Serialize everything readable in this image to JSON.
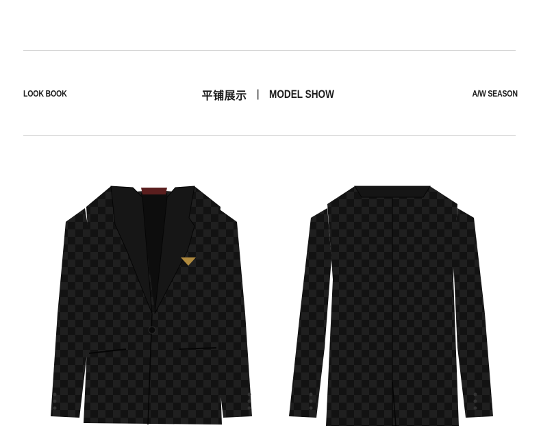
{
  "header": {
    "left_label": "LOOK BOOK",
    "center_title_cn": "平铺展示",
    "separator": "|",
    "center_title_en": "MODEL SHOW",
    "right_label": "A/W SEASON"
  },
  "images": {
    "front": {
      "subject": "black checkered blazer front view"
    },
    "back": {
      "subject": "black checkered blazer back view"
    }
  },
  "colors": {
    "rule": "#cfcfcf",
    "text": "#1c1c1c",
    "fabric_dark": "#111111",
    "fabric_check": "#1e1e1e"
  }
}
